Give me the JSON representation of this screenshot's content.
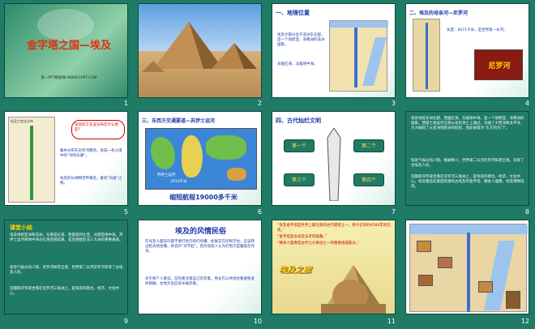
{
  "slides": [
    {
      "num": "1",
      "title": "金字塔之国—埃及",
      "subtitle": "第一PPT模板网-WWW.1PPT.COM"
    },
    {
      "num": "2"
    },
    {
      "num": "3",
      "heading": "一、地理位置",
      "text1": "埃及大部分位于非洲东北部，是一个地跨亚、非两洲的非洲国家。",
      "text2": "东临红海，北临地中海。"
    },
    {
      "num": "4",
      "heading": "二、埃及的母亲河—尼罗河",
      "text1": "长度：6671千米，是世界第一长河。",
      "label": "尼罗河"
    },
    {
      "num": "5",
      "map_title": "埃及工农业分布",
      "bubble": "埃及的工农业分布在什么地区？",
      "text1": "集中分布在尼罗河两岸。形成一条沙漠中的“绿色长廊”。",
      "text2": "埃及的长绒棉世界著名，素有“白金”之称。"
    },
    {
      "num": "6",
      "heading": "三、东西方交通要道—苏伊士运河",
      "label1": "苏伊士运河",
      "label2": "2910千米",
      "caption": "缩短航程19000多千米"
    },
    {
      "num": "7",
      "heading": "四、古代灿烂文明",
      "box1": "第一个",
      "box2": "第二个",
      "box3": "第三个",
      "box4": "第四个"
    },
    {
      "num": "8",
      "text": "埃及地处非洲北部，西临红海，东临地中海，是一个地跨亚、非两洲的国家。西部土地运河全部从埃及领土上通过，沟通了大西洋和太平洋，大大缩短了从亚洲到欧洲的航程，因此被誉为“东方的大门”。",
      "text2": "埃及气候炎热少雨，植被稀少。世界第二长河尼罗河纵贯全境，孕育了古埃及人民。",
      "text3": "首都新开罗就坐落在尼罗河三角洲上，是埃及的政治、经济、文化中心。埃及著名的旅游资源有古埃及的金字塔、狮身人面像、埃及博物馆等。"
    },
    {
      "num": "9",
      "heading": "课堂小结",
      "text": "埃及地跨亚洲和非洲，东部是红海、西部是利比亚，北部是地中海。苏伊士运河将地中海与红海连接起来，是连接欧亚非三大洲的重要通道。",
      "text2": "埃及气候炎热少雨，尼罗河纵贯全境，世界第二长河尼罗河孕育了古埃及人民。",
      "text3": "首都新开罗就坐落在尼罗河三角洲上，是埃及的政治、经济、文化中心。"
    },
    {
      "num": "10",
      "heading": "埃及的风情民俗",
      "text": "在埃及人面前尽量不要打哈欠和打喷嚏，如果实在控制不住，应该转过脸去捂住嘴，并说声“对不起”。因为埃及人认为打哈欠是魔鬼在作祟。",
      "text2": "对于每个人来说，首先要注意自己的衣着，男女在公共场合要避免身体接触，女性外出应穿长袖衣服。"
    },
    {
      "num": "11",
      "line1": "“埃及金字塔是世界上最壮观的古代建筑之一，距今已有约4500年的历史。”",
      "line2": "“金字塔是古埃及法老的陵墓。”",
      "line3": "“狮身人面像是古代七大奇迹之一的重要组成部分。”",
      "caption": "埃及之旅"
    },
    {
      "num": "12"
    }
  ]
}
